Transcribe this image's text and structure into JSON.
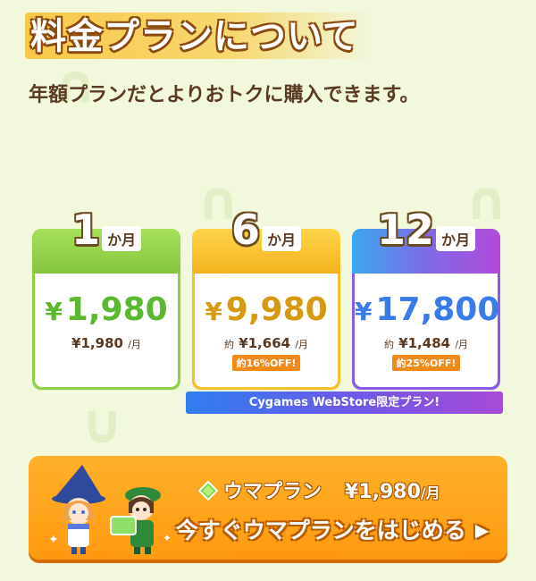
{
  "title": "料金プランについて",
  "subtitle": "年額プランだとよりおトクに購入できます。",
  "plans": [
    {
      "months": "1",
      "months_unit": "か月",
      "price_symbol": "¥",
      "price": "1,980",
      "per_month_prefix": "",
      "per_month": "¥1,980",
      "per_month_unit": "/月",
      "discount": ""
    },
    {
      "months": "6",
      "months_unit": "か月",
      "price_symbol": "¥",
      "price": "9,980",
      "per_month_prefix": "約",
      "per_month": "¥1,664",
      "per_month_unit": "/月",
      "discount": "約16%OFF!"
    },
    {
      "months": "12",
      "months_unit": "か月",
      "price_symbol": "¥",
      "price": "17,800",
      "per_month_prefix": "約",
      "per_month": "¥1,484",
      "per_month_unit": "/月",
      "discount": "約25%OFF!"
    }
  ],
  "store_banner": "Cygames WebStore限定プラン!",
  "cta": {
    "plan_name": "ウマプラン",
    "price": "¥1,980",
    "price_unit": "/月",
    "label": "今すぐウマプランをはじめる",
    "arrow_icon": "play-arrow-icon"
  },
  "colors": {
    "background": "#f2f8dc",
    "plan_1_accent": "#5cb82e",
    "plan_6_accent": "#f3b21e",
    "plan_12_accent": "#3a7bea",
    "cta": "#ff9a10",
    "discount": "#f28a1a"
  }
}
